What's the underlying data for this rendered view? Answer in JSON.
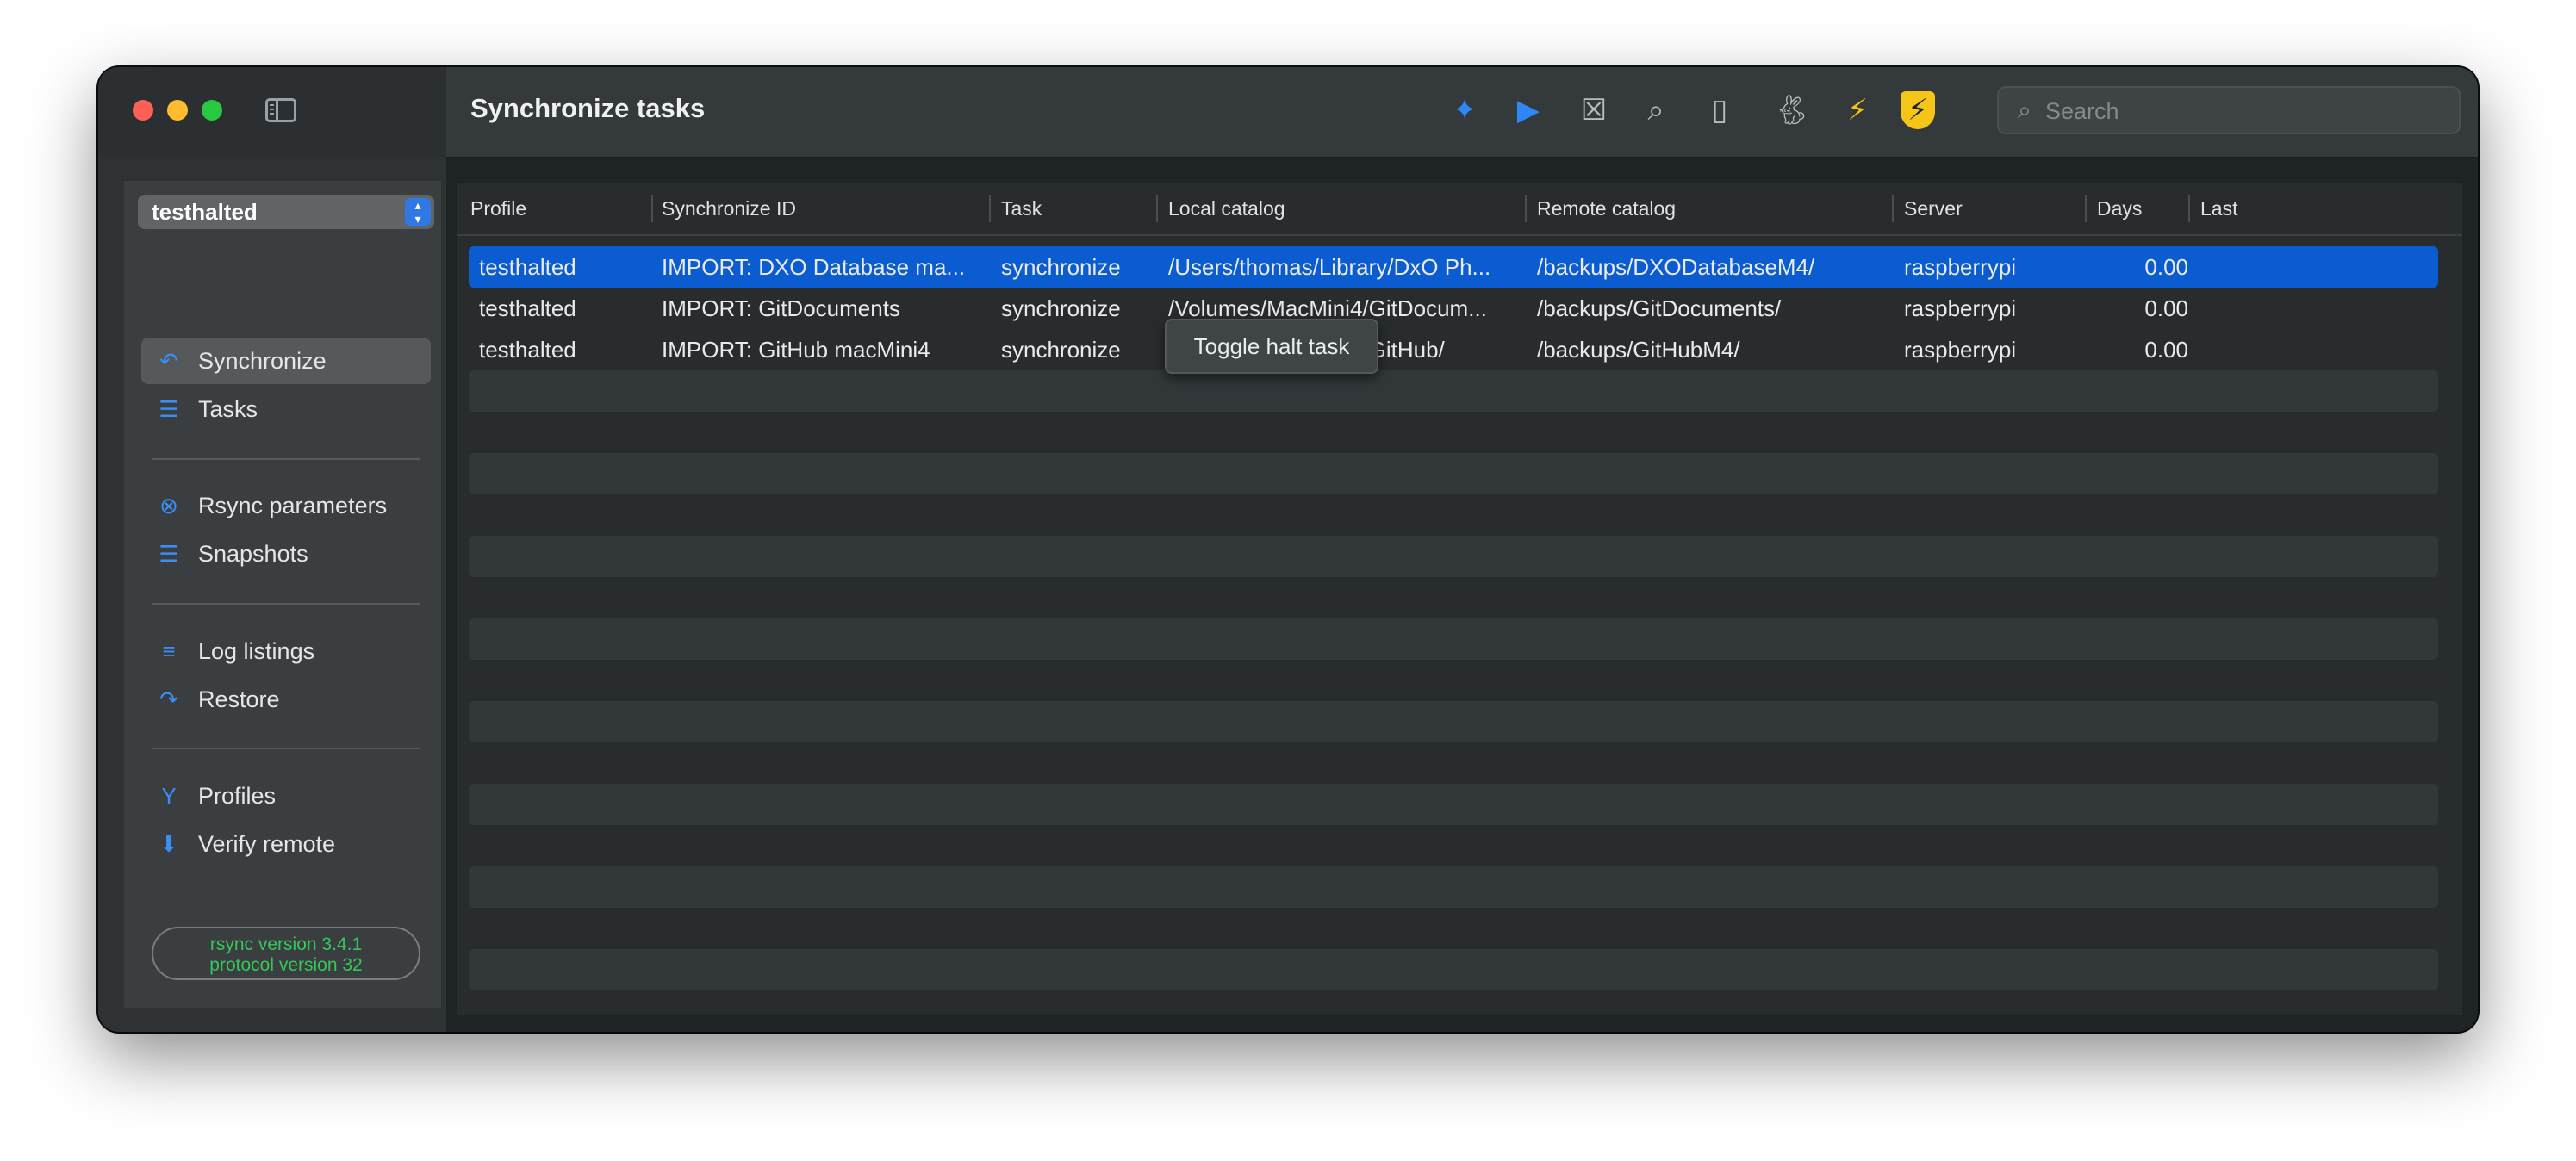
{
  "window": {
    "title": "Synchronize tasks"
  },
  "sidebar": {
    "profile_selector": "testhalted",
    "items": [
      {
        "label": "Synchronize",
        "icon": "synchronize-arrow-icon",
        "selected": true
      },
      {
        "label": "Tasks",
        "icon": "tasks-list-icon",
        "selected": false
      },
      {
        "label": "Rsync parameters",
        "icon": "gear-x-icon",
        "selected": false
      },
      {
        "label": "Snapshots",
        "icon": "snapshots-list-icon",
        "selected": false
      },
      {
        "label": "Log listings",
        "icon": "log-lines-icon",
        "selected": false
      },
      {
        "label": "Restore",
        "icon": "restore-arrow-icon",
        "selected": false
      },
      {
        "label": "Profiles",
        "icon": "profiles-fork-icon",
        "selected": false
      },
      {
        "label": "Verify remote",
        "icon": "download-circle-icon",
        "selected": false
      }
    ],
    "rsync_version": "rsync  version 3.4.1",
    "protocol_version": "protocol version 32"
  },
  "toolbar": {
    "icons": [
      "magic-wand-icon",
      "play-icon",
      "abort-x-icon",
      "zoom-icon",
      "document-icon",
      "rabbit-icon",
      "bolt-shield-outline-icon",
      "bolt-shield-filled-icon"
    ],
    "search_placeholder": "Search"
  },
  "table": {
    "columns": [
      "Profile",
      "Synchronize ID",
      "Task",
      "Local catalog",
      "Remote catalog",
      "Server",
      "Days",
      "Last"
    ],
    "rows": [
      {
        "profile": "testhalted",
        "sync_id": "IMPORT: DXO Database ma...",
        "task": "synchronize",
        "local": "/Users/thomas/Library/DxO Ph...",
        "remote": "/backups/DXODatabaseM4/",
        "server": "raspberrypi",
        "days": "0.00",
        "last": ""
      },
      {
        "profile": "testhalted",
        "sync_id": "IMPORT: GitDocuments",
        "task": "synchronize",
        "local": "/Volumes/MacMini4/GitDocum...",
        "remote": "/backups/GitDocuments/",
        "server": "raspberrypi",
        "days": "0.00",
        "last": ""
      },
      {
        "profile": "testhalted",
        "sync_id": "IMPORT: GitHub macMini4",
        "task": "synchronize",
        "local": "/Volumes/MacMini4/GitHub/",
        "remote": "/backups/GitHubM4/",
        "server": "raspberrypi",
        "days": "0.00",
        "last": ""
      }
    ],
    "selected_row": 0
  },
  "tooltip": "Toggle halt task",
  "colors": {
    "accent": "#0a5cd0",
    "rsync_text": "#35c759",
    "shield": "#f5c518"
  }
}
